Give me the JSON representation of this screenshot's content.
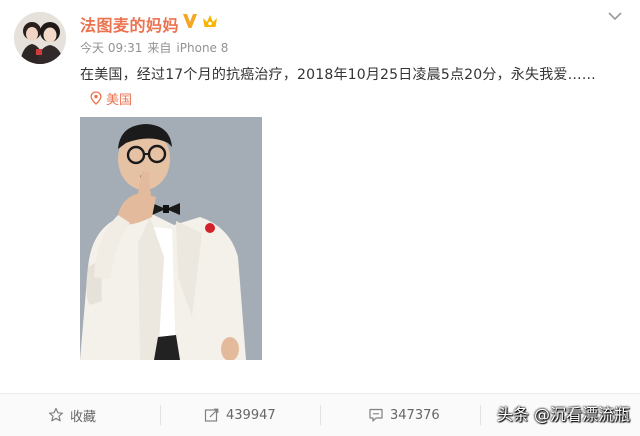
{
  "post": {
    "username": "法图麦的妈妈",
    "badges": [
      "vip-v-icon",
      "member-crown-icon"
    ],
    "meta": {
      "time": "今天 09:31",
      "source_prefix": "来自",
      "device": "iPhone 8"
    },
    "text": "在美国，经过17个月的抗癌治疗，2018年10月25日凌晨5点20分，永失我爱……",
    "location": "美国"
  },
  "actions": {
    "favorite_label": "收藏",
    "repost_count": "439947",
    "comment_count": "347376"
  },
  "watermark": "头条 @沉看漂流瓶",
  "colors": {
    "username": "#eb7350",
    "meta": "#929292",
    "text": "#333333",
    "photo_background": "#a6b0b8",
    "action_bar": "#fafafa"
  }
}
